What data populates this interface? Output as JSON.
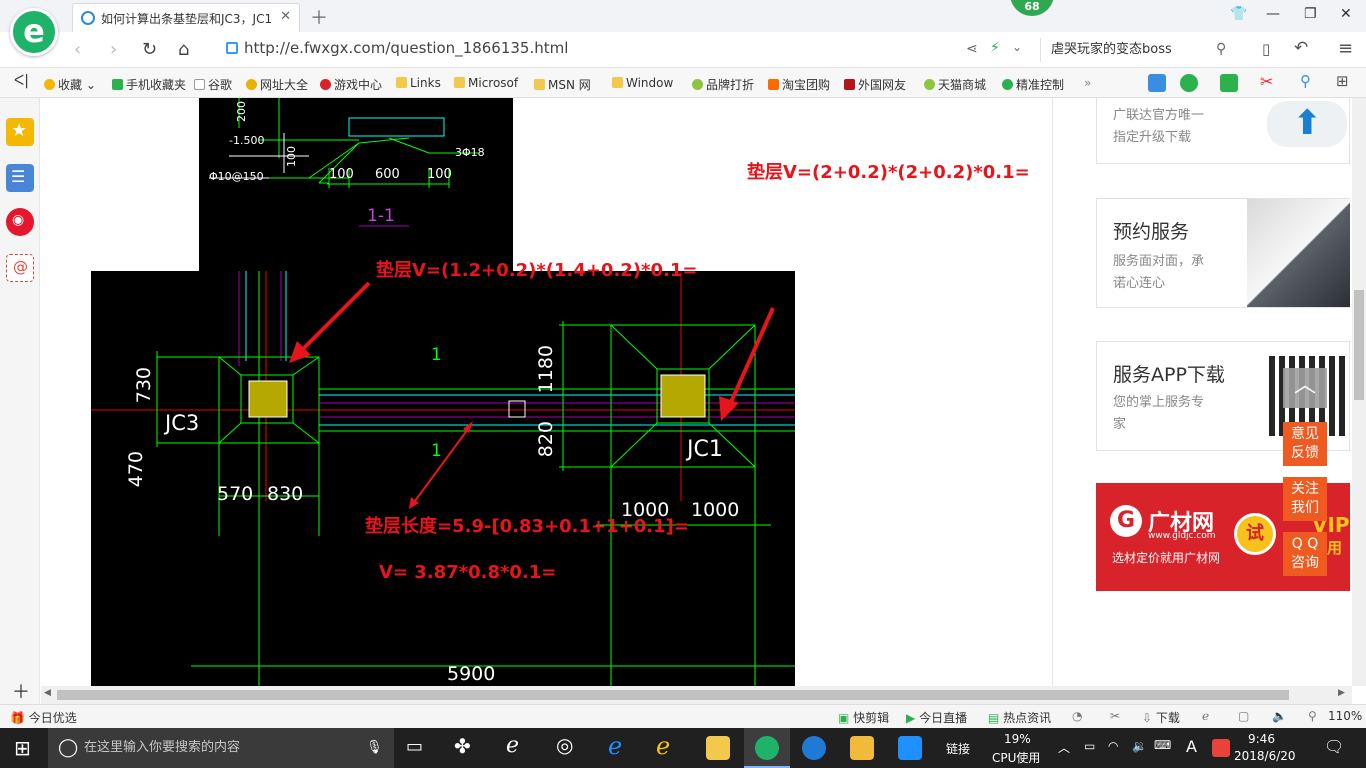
{
  "browser": {
    "tab_title": "如何计算出条基垫层和JC3，JC1",
    "badge": "68",
    "url": "http://e.fwxgx.com/question_1866135.html",
    "search_text": "虐哭玩家的变态boss"
  },
  "bookmarks": [
    "收藏",
    "手机收藏夹",
    "谷歌",
    "网址大全",
    "游戏中心",
    "Links",
    "Microsof",
    "MSN 网",
    "Window",
    "品牌打折",
    "淘宝团购",
    "外国网友",
    "天猫商城",
    "精准控制"
  ],
  "drawing": {
    "section_label": "1-1",
    "top_dims": [
      "-1.500",
      "100",
      "600",
      "100",
      "Φ10@150",
      "3Φ18",
      "200",
      "100"
    ],
    "dims": {
      "d730": "730",
      "d470": "470",
      "d570": "570",
      "d830": "830",
      "d1180": "1180",
      "d820": "820",
      "d1000a": "1000",
      "d1000b": "1000",
      "d5900": "5900",
      "label_jc3": "JC3",
      "label_jc1": "JC1",
      "mark1a": "1",
      "mark1b": "1"
    },
    "annotations": {
      "a1": "垫层V=(2+0.2)*(2+0.2)*0.1=",
      "a2": "垫层V=(1.2+0.2)*(1.4+0.2)*0.1=",
      "a3": "垫层长度=5.9-[0.83+0.1+1+0.1]=",
      "a4": "V= 3.87*0.8*0.1="
    }
  },
  "side_panel": {
    "upgrade": {
      "line1": "广联达官方唯一",
      "line2": "指定升级下载"
    },
    "reserve": {
      "title": "预约服务",
      "line1": "服务面对面，承",
      "line2": "诺心连心"
    },
    "app": {
      "title": "服务APP下载",
      "line1": "您的掌上服务专",
      "line2": "家"
    },
    "ad": {
      "brand": "广材网",
      "domain": "www.gldjc.com",
      "slogan": "选材定价就用广材网",
      "try": "试",
      "vip": "VIP",
      "vip2": "试用"
    }
  },
  "float_buttons": {
    "feedback1": "意见",
    "feedback2": "反馈",
    "follow1": "关注",
    "follow2": "我们",
    "qq1": "Q Q",
    "qq2": "咨询"
  },
  "status_bar": {
    "left": "今日优选",
    "items": [
      "快剪辑",
      "今日直播",
      "热点资讯",
      "下载"
    ],
    "zoom": "110%"
  },
  "taskbar": {
    "search_placeholder": "在这里输入你要搜索的内容",
    "link_label": "链接",
    "cpu_percent": "19%",
    "cpu_label": "CPU使用",
    "time": "9:46",
    "date": "2018/6/20",
    "ime": "A"
  }
}
